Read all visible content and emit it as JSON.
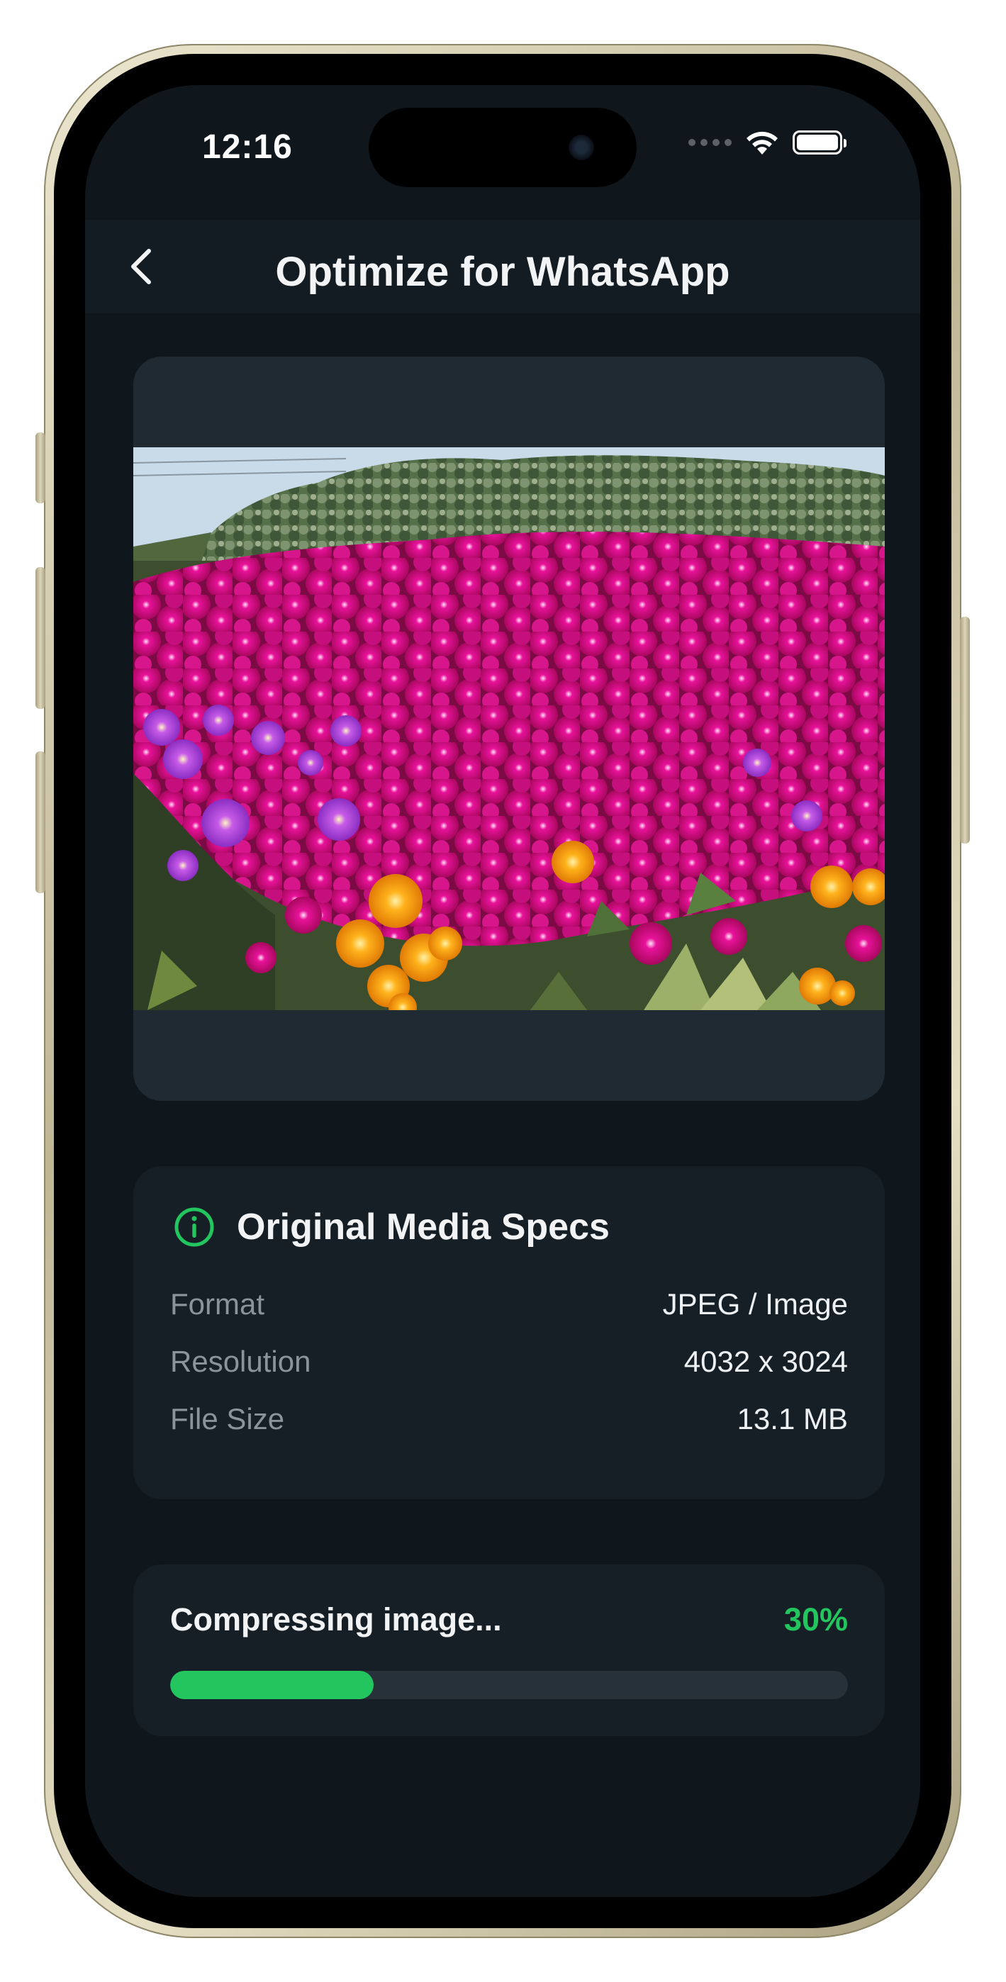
{
  "status_bar": {
    "time": "12:16"
  },
  "header": {
    "title": "Optimize for WhatsApp"
  },
  "preview": {
    "image_alt": "Magenta and orange iceplant flowers in front of green shrubs"
  },
  "specs": {
    "title": "Original Media Specs",
    "rows": [
      {
        "label": "Format",
        "value": "JPEG / Image"
      },
      {
        "label": "Resolution",
        "value": "4032 x 3024"
      },
      {
        "label": "File Size",
        "value": "13.1 MB"
      }
    ]
  },
  "progress": {
    "label": "Compressing image...",
    "percent_text": "30%",
    "fraction": 0.3
  },
  "colors": {
    "accent": "#22c55e",
    "background": "#0f171d",
    "card": "#161f26"
  }
}
